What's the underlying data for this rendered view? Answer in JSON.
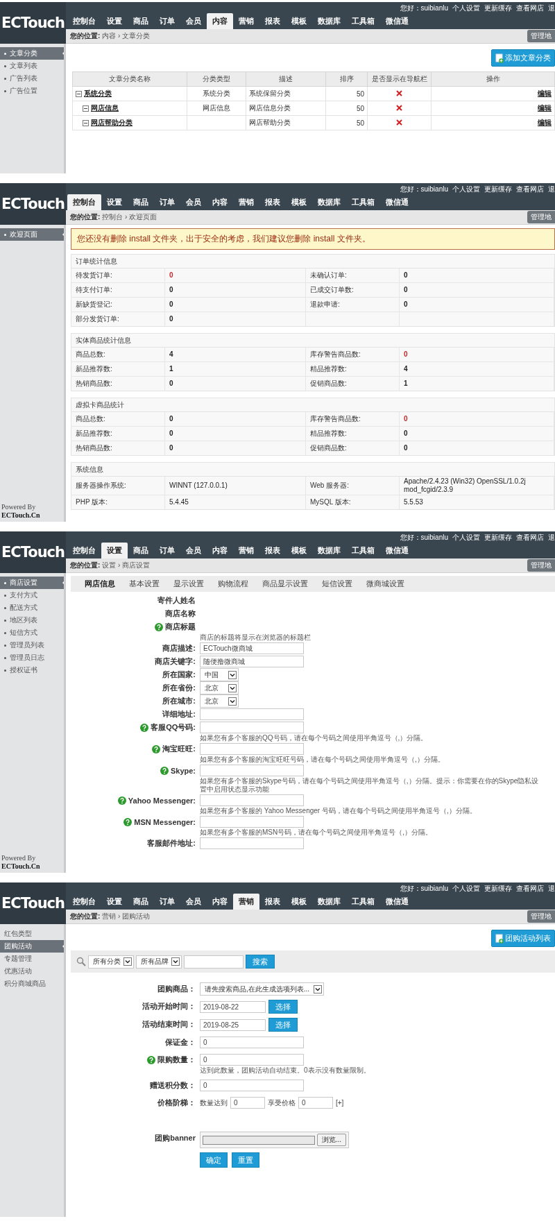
{
  "screens": [
    {
      "header": {
        "logo": "ECTouch",
        "user_links": [
          "您好：suibianlu",
          "个人设置",
          "更新缓存",
          "查看网店",
          "退"
        ],
        "nav": [
          {
            "label": "控制台",
            "selected": false
          },
          {
            "label": "设置",
            "selected": false
          },
          {
            "label": "商品",
            "selected": false
          },
          {
            "label": "订单",
            "selected": false
          },
          {
            "label": "会员",
            "selected": false
          },
          {
            "label": "内容",
            "selected": true
          },
          {
            "label": "营销",
            "selected": false
          },
          {
            "label": "报表",
            "selected": false
          },
          {
            "label": "模板",
            "selected": false
          },
          {
            "label": "数据库",
            "selected": false
          },
          {
            "label": "工具箱",
            "selected": false
          },
          {
            "label": "微信通",
            "selected": false
          }
        ]
      },
      "breadcrumb": "**您的位置:** 内容 › 文章分类",
      "map_button": "管理地",
      "sidebar": {
        "bulleted": true,
        "items": [
          {
            "label": "文章分类",
            "selected": true
          },
          {
            "label": "文章列表",
            "selected": false
          },
          {
            "label": "广告列表",
            "selected": false
          },
          {
            "label": "广告位置",
            "selected": false
          }
        ]
      },
      "content": {
        "kind": "category_table",
        "add_button": "添加文章分类",
        "columns": [
          "文章分类名称",
          "分类类型",
          "描述",
          "排序",
          "是否显示在导航栏",
          "操作"
        ],
        "rows": [
          {
            "name": "系统分类",
            "type": "系统分类",
            "description": "系统保留分类",
            "sort": "50",
            "show_in_nav": false,
            "action": "编辑",
            "expanded": true,
            "children": [
              {
                "name": "网店信息",
                "type": "网店信息",
                "description": "网店信息分类",
                "sort": "50",
                "show_in_nav": false,
                "action": "编辑",
                "expanded": true
              },
              {
                "name": "网店帮助分类",
                "description": "网店帮助分类",
                "sort": "50",
                "show_in_nav": false,
                "action": "编辑",
                "expanded": true
              }
            ]
          }
        ]
      }
    },
    {
      "header": {
        "logo": "ECTouch",
        "user_links": [
          "您好：suibianlu",
          "个人设置",
          "更新缓存",
          "查看网店",
          "退"
        ],
        "nav": [
          {
            "label": "控制台",
            "selected": true
          },
          {
            "label": "设置",
            "selected": false
          },
          {
            "label": "商品",
            "selected": false
          },
          {
            "label": "订单",
            "selected": false
          },
          {
            "label": "会员",
            "selected": false
          },
          {
            "label": "内容",
            "selected": false
          },
          {
            "label": "营销",
            "selected": false
          },
          {
            "label": "报表",
            "selected": false
          },
          {
            "label": "模板",
            "selected": false
          },
          {
            "label": "数据库",
            "selected": false
          },
          {
            "label": "工具箱",
            "selected": false
          },
          {
            "label": "微信通",
            "selected": false
          }
        ]
      },
      "breadcrumb": "**您的位置:** 控制台 › 欢迎页面",
      "map_button": "管理地",
      "sidebar": {
        "bulleted": true,
        "items": [
          {
            "label": "欢迎页面",
            "selected": true
          }
        ]
      },
      "footer": "Powered By **ECTouch.Cn**",
      "content": {
        "kind": "dashboard",
        "warning": "您还没有删除 install 文件夹，出于安全的考虑，我们建议您删除 install 文件夹。",
        "sections": [
          {
            "title": "订单统计信息",
            "kind": "stats",
            "rows": [
              [
                {
                  "label": "待发货订单:",
                  "value": "0",
                  "alert": true
                },
                {
                  "label": "未确认订单:",
                  "value": "0",
                  "alert": false
                }
              ],
              [
                {
                  "label": "待支付订单:",
                  "value": "0",
                  "alert": false
                },
                {
                  "label": "已成交订单数:",
                  "value": "0",
                  "alert": false
                }
              ],
              [
                {
                  "label": "新缺货登记:",
                  "value": "0",
                  "alert": false
                },
                {
                  "label": "退款申请:",
                  "value": "0",
                  "alert": false
                }
              ],
              [
                {
                  "label": "部分发货订单:",
                  "value": "0",
                  "alert": false
                }
              ]
            ]
          },
          {
            "title": "实体商品统计信息",
            "kind": "stats",
            "rows": [
              [
                {
                  "label": "商品总数:",
                  "value": "4",
                  "alert": false
                },
                {
                  "label": "库存警告商品数:",
                  "value": "0",
                  "alert": true
                }
              ],
              [
                {
                  "label": "新品推荐数:",
                  "value": "1",
                  "alert": false
                },
                {
                  "label": "精品推荐数:",
                  "value": "4",
                  "alert": false
                }
              ],
              [
                {
                  "label": "热销商品数:",
                  "value": "0",
                  "alert": false
                },
                {
                  "label": "促销商品数:",
                  "value": "1",
                  "alert": false
                }
              ]
            ]
          },
          {
            "title": "虚拟卡商品统计",
            "kind": "stats",
            "rows": [
              [
                {
                  "label": "商品总数:",
                  "value": "0",
                  "alert": false
                },
                {
                  "label": "库存警告商品数:",
                  "value": "0",
                  "alert": true
                }
              ],
              [
                {
                  "label": "新品推荐数:",
                  "value": "0",
                  "alert": false
                },
                {
                  "label": "精品推荐数:",
                  "value": "0",
                  "alert": false
                }
              ],
              [
                {
                  "label": "热销商品数:",
                  "value": "0",
                  "alert": false
                },
                {
                  "label": "促销商品数:",
                  "value": "0",
                  "alert": false
                }
              ]
            ]
          },
          {
            "title": "系统信息",
            "kind": "info",
            "rows": [
              [
                {
                  "label": "服务器操作系统:",
                  "value": "WINNT (127.0.0.1)",
                  "alert": false
                },
                {
                  "label": "Web 服务器:",
                  "value": "Apache/2.4.23 (Win32) OpenSSL/1.0.2j mod_fcgid/2.3.9",
                  "alert": false
                }
              ],
              [
                {
                  "label": "PHP 版本:",
                  "value": "5.4.45",
                  "alert": false
                },
                {
                  "label": "MySQL 版本:",
                  "value": "5.5.53",
                  "alert": false
                }
              ]
            ]
          }
        ]
      }
    },
    {
      "header": {
        "logo": "ECTouch",
        "user_links": [
          "您好：suibianlu",
          "个人设置",
          "更新缓存",
          "查看网店",
          "退"
        ],
        "nav": [
          {
            "label": "控制台",
            "selected": false
          },
          {
            "label": "设置",
            "selected": true
          },
          {
            "label": "商品",
            "selected": false
          },
          {
            "label": "订单",
            "selected": false
          },
          {
            "label": "会员",
            "selected": false
          },
          {
            "label": "内容",
            "selected": false
          },
          {
            "label": "营销",
            "selected": false
          },
          {
            "label": "报表",
            "selected": false
          },
          {
            "label": "模板",
            "selected": false
          },
          {
            "label": "数据库",
            "selected": false
          },
          {
            "label": "工具箱",
            "selected": false
          },
          {
            "label": "微信通",
            "selected": false
          }
        ]
      },
      "breadcrumb": "**您的位置:** 设置 › 商店设置",
      "map_button": "管理地",
      "sidebar": {
        "bulleted": true,
        "items": [
          {
            "label": "商店设置",
            "selected": true
          },
          {
            "label": "支付方式",
            "selected": false
          },
          {
            "label": "配送方式",
            "selected": false
          },
          {
            "label": "地区列表",
            "selected": false
          },
          {
            "label": "短信方式",
            "selected": false
          },
          {
            "label": "管理员列表",
            "selected": false
          },
          {
            "label": "管理员日志",
            "selected": false
          },
          {
            "label": "授权证书",
            "selected": false
          }
        ]
      },
      "footer": "Powered By **ECTouch.Cn**",
      "content": {
        "kind": "settings",
        "tabs": [
          {
            "label": "网店信息",
            "selected": true
          },
          {
            "label": "基本设置",
            "selected": false
          },
          {
            "label": "显示设置",
            "selected": false
          },
          {
            "label": "购物流程",
            "selected": false
          },
          {
            "label": "商品显示设置",
            "selected": false
          },
          {
            "label": "短信设置",
            "selected": false
          },
          {
            "label": "微商城设置",
            "selected": false
          }
        ],
        "fields": [
          {
            "label": "寄件人姓名",
            "kind": "none",
            "help": false
          },
          {
            "label": "商店名称",
            "kind": "none",
            "help": false
          },
          {
            "label": "商店标题",
            "kind": "none",
            "help": true,
            "hint": "商店的标题将显示在浏览器的标题栏"
          },
          {
            "label": "商店描述:",
            "kind": "text",
            "help": false,
            "value": "ECTouch微商城"
          },
          {
            "label": "商店关键字:",
            "kind": "text",
            "help": false,
            "value": "随便撸微商城"
          },
          {
            "label": "所在国家:",
            "kind": "select",
            "help": false,
            "value": "中国"
          },
          {
            "label": "所在省份:",
            "kind": "select",
            "help": false,
            "value": "北京"
          },
          {
            "label": "所在城市:",
            "kind": "select",
            "help": false,
            "value": "北京"
          },
          {
            "label": "详细地址:",
            "kind": "text",
            "help": false
          },
          {
            "label": "客服QQ号码:",
            "kind": "text",
            "help": true,
            "hint": "如果您有多个客服的QQ号码，请在每个号码之间使用半角逗号（,）分隔。"
          },
          {
            "label": "淘宝旺旺:",
            "kind": "text",
            "help": true,
            "hint": "如果您有多个客服的淘宝旺旺号码，请在每个号码之间使用半角逗号（,）分隔。"
          },
          {
            "label": "Skype:",
            "kind": "text",
            "help": true,
            "hint": "如果您有多个客服的Skype号码，请在每个号码之间使用半角逗号（,）分隔。提示：你需要在你的Skype隐私设置中启用状态显示功能"
          },
          {
            "label": "Yahoo Messenger:",
            "kind": "text",
            "help": true,
            "hint": "如果您有多个客服的 Yahoo Messenger 号码，请在每个号码之间使用半角逗号（,）分隔。"
          },
          {
            "label": "MSN Messenger:",
            "kind": "text",
            "help": true,
            "hint": "如果您有多个客服的MSN号码，请在每个号码之间使用半角逗号（,）分隔。"
          },
          {
            "label": "客服邮件地址:",
            "kind": "text",
            "help": false
          }
        ]
      }
    },
    {
      "header": {
        "logo": "ECTouch",
        "user_links": [
          "您好：suibianlu",
          "个人设置",
          "更新缓存",
          "查看网店",
          "退"
        ],
        "nav": [
          {
            "label": "控制台",
            "selected": false
          },
          {
            "label": "设置",
            "selected": false
          },
          {
            "label": "商品",
            "selected": false
          },
          {
            "label": "订单",
            "selected": false
          },
          {
            "label": "会员",
            "selected": false
          },
          {
            "label": "内容",
            "selected": false
          },
          {
            "label": "营销",
            "selected": true
          },
          {
            "label": "报表",
            "selected": false
          },
          {
            "label": "模板",
            "selected": false
          },
          {
            "label": "数据库",
            "selected": false
          },
          {
            "label": "工具箱",
            "selected": false
          },
          {
            "label": "微信通",
            "selected": false
          }
        ]
      },
      "breadcrumb": "**您的位置:** 营销 › 团购活动",
      "map_button": "管理地",
      "sidebar": {
        "bulleted": false,
        "items": [
          {
            "label": "红包类型",
            "selected": false
          },
          {
            "label": "团购活动",
            "selected": true
          },
          {
            "label": "专题管理",
            "selected": false
          },
          {
            "label": "优惠活动",
            "selected": false
          },
          {
            "label": "积分商城商品",
            "selected": false
          }
        ]
      },
      "content": {
        "kind": "groupbuy",
        "list_button": "团购活动列表",
        "search": {
          "category": "所有分类",
          "brand": "所有品牌",
          "button": "搜索"
        },
        "fields": [
          {
            "label": "团购商品：",
            "kind": "select",
            "help": false,
            "value": "请先搜索商品,在此生成选项列表..."
          },
          {
            "label": "活动开始时间：",
            "kind": "date",
            "help": false,
            "value": "2019-08-22",
            "button": "选择"
          },
          {
            "label": "活动结束时间：",
            "kind": "date",
            "help": false,
            "value": "2019-08-25",
            "button": "选择"
          },
          {
            "label": "保证金：",
            "kind": "text",
            "help": false,
            "value": "0"
          },
          {
            "label": "限购数量：",
            "kind": "text",
            "help": true,
            "value": "0",
            "hint": "达到此数量，团购活动自动结束。0表示没有数量限制。"
          },
          {
            "label": "赠送积分数：",
            "kind": "text",
            "help": false,
            "value": "0"
          },
          {
            "label": "价格阶梯：",
            "kind": "ladder",
            "help": false,
            "qty_label": "数量达到",
            "qty": "0",
            "price_label": "享受价格",
            "price": "0",
            "add": "[+]"
          },
          {
            "label": "团购banner",
            "kind": "file",
            "help": false,
            "button": "浏览..."
          }
        ],
        "actions": [
          "确定",
          "重置"
        ]
      }
    }
  ]
}
